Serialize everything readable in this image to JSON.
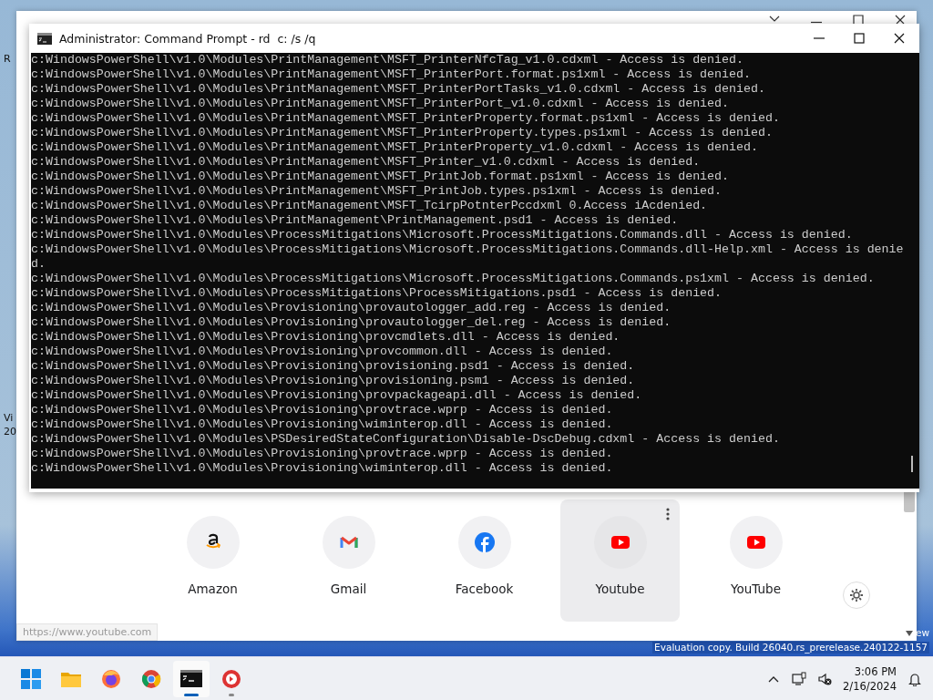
{
  "desktop": {
    "icon_labels": [
      {
        "text": "R"
      },
      {
        "text": "Vi"
      },
      {
        "text": "20"
      }
    ],
    "watermark": [
      "ew",
      "Evaluation copy. Build 26040.rs_prerelease.240122-1157"
    ]
  },
  "browser": {
    "shortcuts": [
      {
        "label": "Amazon",
        "kind": "amazon",
        "hovered": false
      },
      {
        "label": "Gmail",
        "kind": "gmail",
        "hovered": false
      },
      {
        "label": "Facebook",
        "kind": "facebook",
        "hovered": false
      },
      {
        "label": "Youtube",
        "kind": "youtube",
        "hovered": true
      },
      {
        "label": "YouTube",
        "kind": "youtube",
        "hovered": false
      }
    ],
    "status_url": "https://www.youtube.com"
  },
  "console": {
    "title": "Administrator: Command Prompt - rd  c: /s /q",
    "lines": [
      "c:WindowsPowerShell\\v1.0\\Modules\\PrintManagement\\MSFT_PrinterNfcTag_v1.0.cdxml - Access is denied.",
      "c:WindowsPowerShell\\v1.0\\Modules\\PrintManagement\\MSFT_PrinterPort.format.ps1xml - Access is denied.",
      "c:WindowsPowerShell\\v1.0\\Modules\\PrintManagement\\MSFT_PrinterPortTasks_v1.0.cdxml - Access is denied.",
      "c:WindowsPowerShell\\v1.0\\Modules\\PrintManagement\\MSFT_PrinterPort_v1.0.cdxml - Access is denied.",
      "c:WindowsPowerShell\\v1.0\\Modules\\PrintManagement\\MSFT_PrinterProperty.format.ps1xml - Access is denied.",
      "c:WindowsPowerShell\\v1.0\\Modules\\PrintManagement\\MSFT_PrinterProperty.types.ps1xml - Access is denied.",
      "c:WindowsPowerShell\\v1.0\\Modules\\PrintManagement\\MSFT_PrinterProperty_v1.0.cdxml - Access is denied.",
      "c:WindowsPowerShell\\v1.0\\Modules\\PrintManagement\\MSFT_Printer_v1.0.cdxml - Access is denied.",
      "c:WindowsPowerShell\\v1.0\\Modules\\PrintManagement\\MSFT_PrintJob.format.ps1xml - Access is denied.",
      "c:WindowsPowerShell\\v1.0\\Modules\\PrintManagement\\MSFT_PrintJob.types.ps1xml - Access is denied.",
      "c:WindowsPowerShell\\v1.0\\Modules\\PrintManagement\\MSFT_TcirpPotnterPccdxml 0.Access iAcdenied.",
      "c:WindowsPowerShell\\v1.0\\Modules\\PrintManagement\\PrintManagement.psd1 - Access is denied.",
      "c:WindowsPowerShell\\v1.0\\Modules\\ProcessMitigations\\Microsoft.ProcessMitigations.Commands.dll - Access is denied.",
      "c:WindowsPowerShell\\v1.0\\Modules\\ProcessMitigations\\Microsoft.ProcessMitigations.Commands.dll-Help.xml - Access is denie",
      "d.",
      "c:WindowsPowerShell\\v1.0\\Modules\\ProcessMitigations\\Microsoft.ProcessMitigations.Commands.ps1xml - Access is denied.",
      "c:WindowsPowerShell\\v1.0\\Modules\\ProcessMitigations\\ProcessMitigations.psd1 - Access is denied.",
      "c:WindowsPowerShell\\v1.0\\Modules\\Provisioning\\provautologger_add.reg - Access is denied.",
      "c:WindowsPowerShell\\v1.0\\Modules\\Provisioning\\provautologger_del.reg - Access is denied.",
      "c:WindowsPowerShell\\v1.0\\Modules\\Provisioning\\provcmdlets.dll - Access is denied.",
      "c:WindowsPowerShell\\v1.0\\Modules\\Provisioning\\provcommon.dll - Access is denied.",
      "c:WindowsPowerShell\\v1.0\\Modules\\Provisioning\\provisioning.psd1 - Access is denied.",
      "c:WindowsPowerShell\\v1.0\\Modules\\Provisioning\\provisioning.psm1 - Access is denied.",
      "c:WindowsPowerShell\\v1.0\\Modules\\Provisioning\\provpackageapi.dll - Access is denied.",
      "c:WindowsPowerShell\\v1.0\\Modules\\Provisioning\\provtrace.wprp - Access is denied.",
      "c:WindowsPowerShell\\v1.0\\Modules\\Provisioning\\wiminterop.dll - Access is denied.",
      "c:WindowsPowerShell\\v1.0\\Modules\\PSDesiredStateConfiguration\\Disable-DscDebug.cdxml - Access is denied.",
      "c:WindowsPowerShell\\v1.0\\Modules\\Provisioning\\provtrace.wprp - Access is denied.",
      "c:WindowsPowerShell\\v1.0\\Modules\\Provisioning\\wiminterop.dll - Access is denied."
    ]
  },
  "taskbar": {
    "apps": [
      {
        "kind": "start",
        "active": false
      },
      {
        "kind": "folder",
        "active": false
      },
      {
        "kind": "firefox",
        "active": false
      },
      {
        "kind": "chrome",
        "active": false
      },
      {
        "kind": "terminal",
        "active": true
      },
      {
        "kind": "recorder",
        "active": false
      }
    ],
    "time": "3:06 PM",
    "date": "2/16/2024"
  }
}
